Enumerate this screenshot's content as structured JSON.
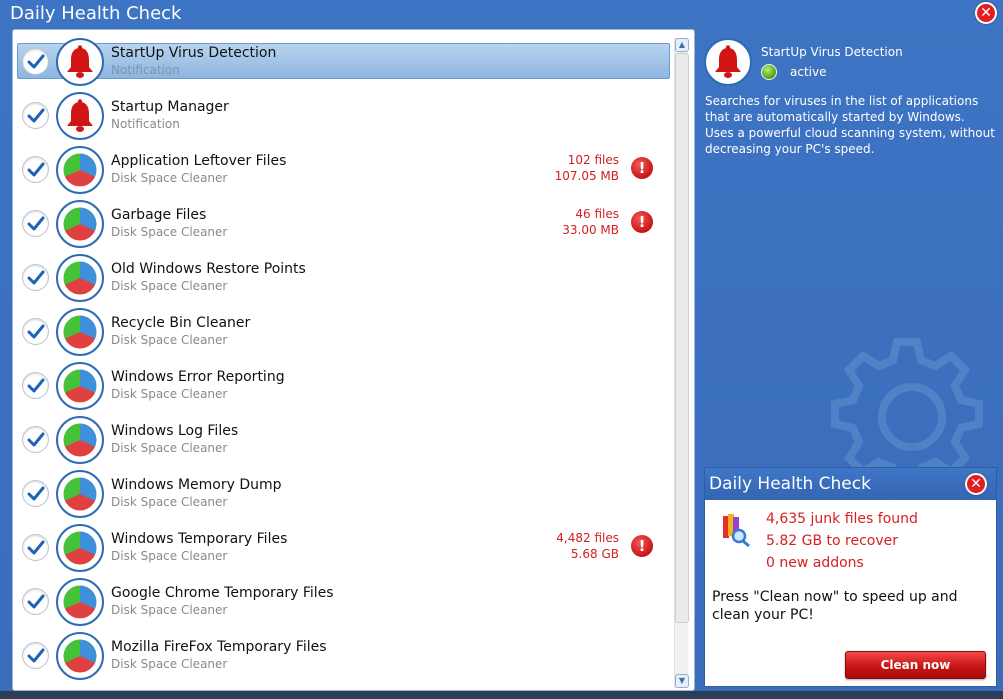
{
  "window": {
    "title": "Daily Health Check"
  },
  "list": {
    "items": [
      {
        "title": "StartUp Virus Detection",
        "subtitle": "Notification",
        "icon": "alarm-bell-icon",
        "checked": true,
        "selected": true,
        "count": "",
        "size": "",
        "warning": false
      },
      {
        "title": "Startup Manager",
        "subtitle": "Notification",
        "icon": "alarm-bell-icon",
        "checked": true,
        "selected": false,
        "count": "",
        "size": "",
        "warning": false
      },
      {
        "title": "Application Leftover Files",
        "subtitle": "Disk Space Cleaner",
        "icon": "disk-pie-icon",
        "checked": true,
        "selected": false,
        "count": "102 files",
        "size": "107.05 MB",
        "warning": true
      },
      {
        "title": "Garbage Files",
        "subtitle": "Disk Space Cleaner",
        "icon": "disk-pie-icon",
        "checked": true,
        "selected": false,
        "count": "46 files",
        "size": "33.00 MB",
        "warning": true
      },
      {
        "title": "Old Windows Restore Points",
        "subtitle": "Disk Space Cleaner",
        "icon": "disk-pie-icon",
        "checked": true,
        "selected": false,
        "count": "",
        "size": "",
        "warning": false
      },
      {
        "title": "Recycle Bin Cleaner",
        "subtitle": "Disk Space Cleaner",
        "icon": "disk-pie-icon",
        "checked": true,
        "selected": false,
        "count": "",
        "size": "",
        "warning": false
      },
      {
        "title": "Windows Error Reporting",
        "subtitle": "Disk Space Cleaner",
        "icon": "disk-pie-icon",
        "checked": true,
        "selected": false,
        "count": "",
        "size": "",
        "warning": false
      },
      {
        "title": "Windows Log Files",
        "subtitle": "Disk Space Cleaner",
        "icon": "disk-pie-icon",
        "checked": true,
        "selected": false,
        "count": "",
        "size": "",
        "warning": false
      },
      {
        "title": "Windows Memory Dump",
        "subtitle": "Disk Space Cleaner",
        "icon": "disk-pie-icon",
        "checked": true,
        "selected": false,
        "count": "",
        "size": "",
        "warning": false
      },
      {
        "title": "Windows Temporary Files",
        "subtitle": "Disk Space Cleaner",
        "icon": "disk-pie-icon",
        "checked": true,
        "selected": false,
        "count": "4,482 files",
        "size": "5.68 GB",
        "warning": true
      },
      {
        "title": "Google Chrome Temporary Files",
        "subtitle": "Disk Space Cleaner",
        "icon": "disk-pie-icon",
        "checked": true,
        "selected": false,
        "count": "",
        "size": "",
        "warning": false
      },
      {
        "title": "Mozilla FireFox Temporary Files",
        "subtitle": "Disk Space Cleaner",
        "icon": "disk-pie-icon",
        "checked": true,
        "selected": false,
        "count": "",
        "size": "",
        "warning": false
      }
    ]
  },
  "details": {
    "title": "StartUp Virus Detection",
    "status": "active",
    "description": "Searches for viruses in the list of applications that are automatically started by Windows. Uses a powerful cloud scanning system, without decreasing your PC's speed."
  },
  "popup": {
    "title": "Daily Health Check",
    "stats": [
      "4,635 junk files found",
      "5.82 GB to recover",
      "0 new addons"
    ],
    "message": "Press \"Clean now\" to speed up and clean your PC!",
    "button_label": "Clean now"
  },
  "colors": {
    "window_bg": "#3a6fb8",
    "alert_red": "#d32020",
    "status_green": "#5aaa1c",
    "icon_border": "#2f6bb4"
  }
}
